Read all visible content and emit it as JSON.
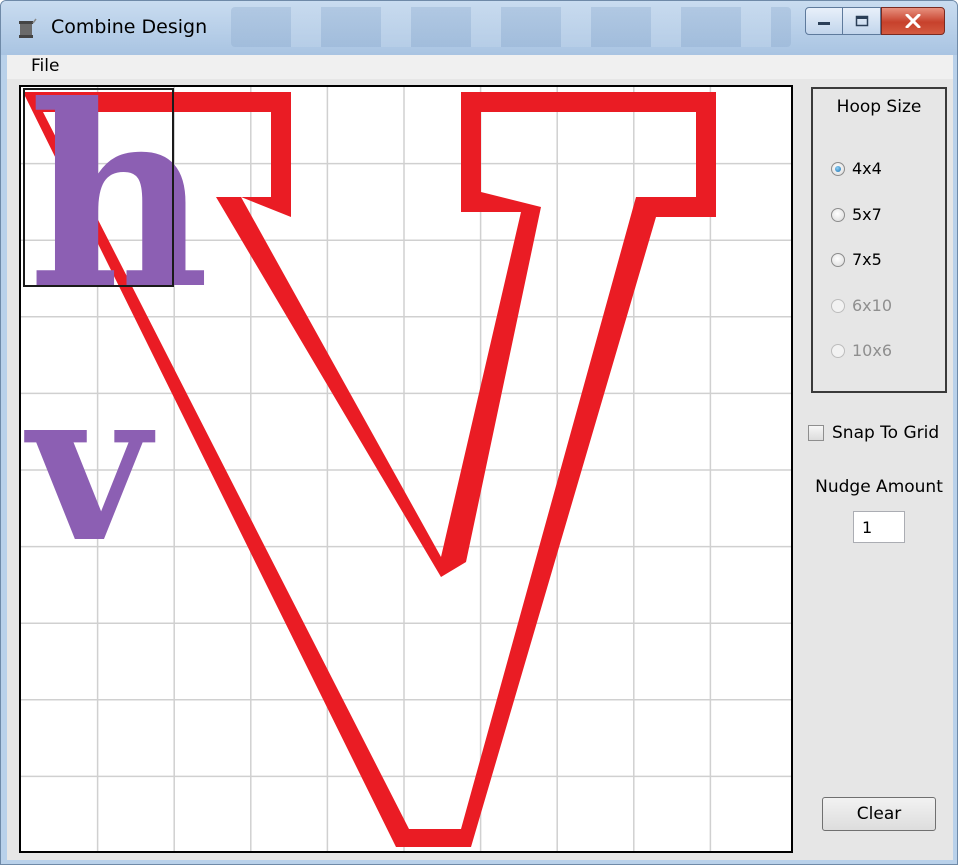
{
  "window": {
    "title": "Combine Design"
  },
  "menu": {
    "file_label": "File"
  },
  "canvas": {
    "hoop_selection": "4x4",
    "letters": [
      {
        "glyph": "h",
        "color": "#8c5fb3"
      },
      {
        "glyph": "v",
        "color": "#8c5fb3"
      },
      {
        "glyph": "V",
        "style": "outline",
        "color": "#ea1c24"
      }
    ]
  },
  "sidebar": {
    "hoop_size_title": "Hoop Size",
    "hoop_options": [
      {
        "label": "4x4",
        "checked": true,
        "enabled": true
      },
      {
        "label": "5x7",
        "checked": false,
        "enabled": true
      },
      {
        "label": "7x5",
        "checked": false,
        "enabled": true
      },
      {
        "label": "6x10",
        "checked": false,
        "enabled": false
      },
      {
        "label": "10x6",
        "checked": false,
        "enabled": false
      }
    ],
    "snap_to_grid_label": "Snap To Grid",
    "snap_to_grid_checked": false,
    "nudge_label": "Nudge Amount",
    "nudge_value": "1",
    "clear_label": "Clear"
  },
  "colors": {
    "stitch_red": "#ea1c24",
    "stitch_purple": "#8c5fb3",
    "grid_line": "#d0d0d0"
  }
}
